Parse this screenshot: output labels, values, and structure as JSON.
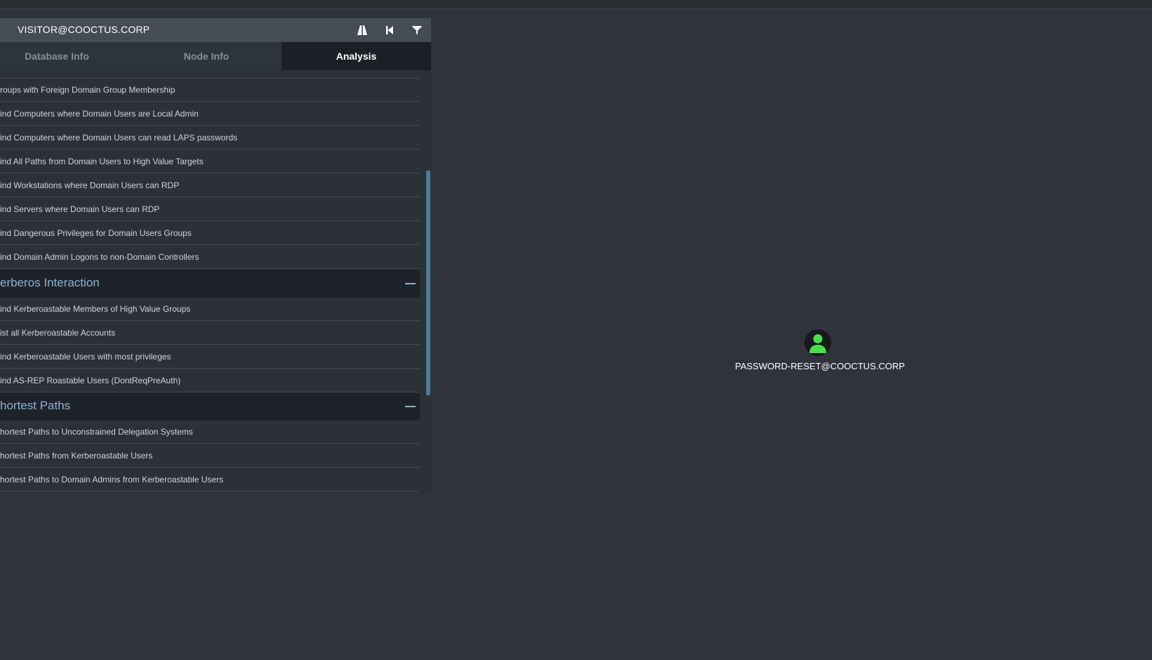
{
  "search": {
    "value": "VISITOR@COOCTUS.CORP"
  },
  "toolbar": {
    "pathfinding_icon": "road-icon",
    "back_icon": "skip-back-icon",
    "filter_icon": "filter-icon"
  },
  "tabs": [
    {
      "label": "Database Info",
      "active": false
    },
    {
      "label": "Node Info",
      "active": false
    },
    {
      "label": "Analysis",
      "active": true
    }
  ],
  "queries_top": [
    "roups with Foreign Domain Group Membership",
    "ind Computers where Domain Users are Local Admin",
    "ind Computers where Domain Users can read LAPS passwords",
    "ind All Paths from Domain Users to High Value Targets",
    "ind Workstations where Domain Users can RDP",
    "ind Servers where Domain Users can RDP",
    "ind Dangerous Privileges for Domain Users Groups",
    "ind Domain Admin Logons to non-Domain Controllers"
  ],
  "sections": [
    {
      "title": "erberos Interaction",
      "queries": [
        "ind Kerberoastable Members of High Value Groups",
        "ist all Kerberoastable Accounts",
        "ind Kerberoastable Users with most privileges",
        "ind AS-REP Roastable Users (DontReqPreAuth)"
      ]
    },
    {
      "title": "hortest Paths",
      "queries": [
        "hortest Paths to Unconstrained Delegation Systems",
        "hortest Paths from Kerberoastable Users",
        "hortest Paths to Domain Admins from Kerberoastable Users"
      ]
    }
  ],
  "graph": {
    "node": {
      "label": "PASSWORD-RESET@COOCTUS.CORP",
      "icon": "user-icon",
      "icon_color": "#4ade4a"
    }
  },
  "colors": {
    "background": "#2f343c",
    "panel": "#2c3138",
    "header": "#454c56",
    "active_tab": "#1b1f26",
    "section_header": "#1e232b",
    "section_text": "#8fb0cf",
    "scroll_thumb": "#4f7b94"
  }
}
